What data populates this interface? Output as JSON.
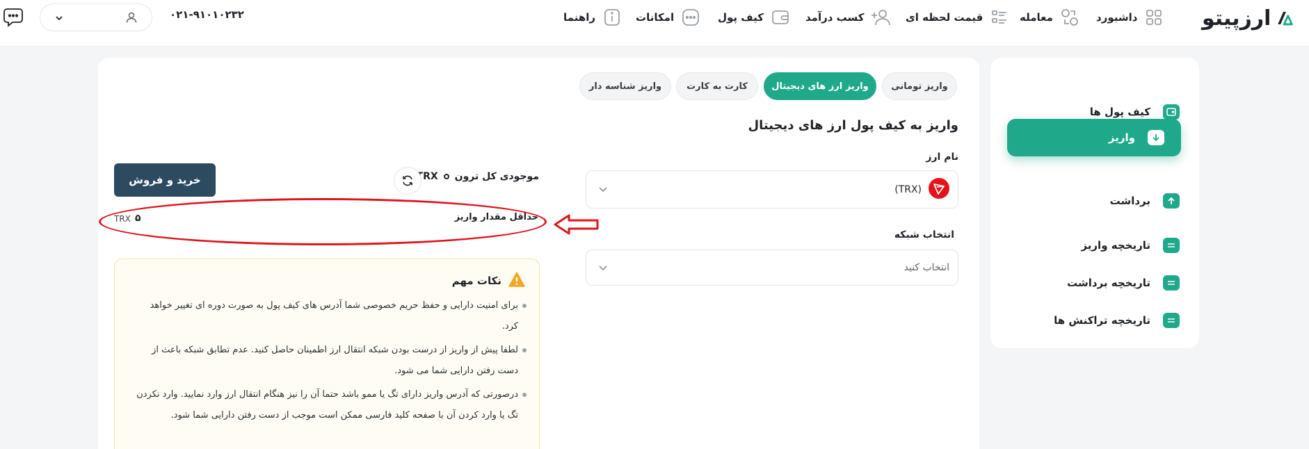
{
  "navbar": {
    "logo_text": "ارزپیتو",
    "items": [
      {
        "label": "داشبورد",
        "icon": "grid-icon"
      },
      {
        "label": "معامله",
        "icon": "exchange-icon"
      },
      {
        "label": "قیمت لحظه ای",
        "icon": "list-icon"
      },
      {
        "label": "کسب درآمد",
        "icon": "user-plus-icon"
      },
      {
        "label": "کیف پول",
        "icon": "wallet-icon"
      },
      {
        "label": "امکانات",
        "icon": "dots-icon"
      },
      {
        "label": "راهنما",
        "icon": "info-icon"
      }
    ],
    "phone": "۰۲۱-۹۱۰۱۰۲۳۲"
  },
  "sidebar": {
    "items": [
      {
        "label": "کیف پول ها"
      },
      {
        "label": "واریز"
      },
      {
        "label": "برداشت"
      },
      {
        "label": "تاریخچه واریز"
      },
      {
        "label": "تاریخچه برداشت"
      },
      {
        "label": "تاریخچه تراکنش ها"
      }
    ],
    "active_index": 1
  },
  "tabs": [
    {
      "label": "واریز تومانی"
    },
    {
      "label": "واریز ارز های دیجیتال"
    },
    {
      "label": "کارت به کارت"
    },
    {
      "label": "واریز شناسه دار"
    }
  ],
  "main": {
    "title": "واریز به کیف پول ارز های دیجیتال",
    "currency_label": "نام ارز",
    "currency_value": "(TRX)",
    "network_label": "انتخاب شبکه",
    "network_placeholder": "انتخاب کنید",
    "balance_label": "موجودی کل ترون",
    "balance_unit": "TRX",
    "buy_sell_label": "خرید و فروش",
    "min_deposit_label": "حداقل مقدار واریز",
    "min_deposit_value": "۵",
    "min_deposit_unit": "TRX"
  },
  "notes": {
    "title": "نکات مهم",
    "items": [
      "برای امنیت دارایی و حفظ حریم خصوصی شما آدرس های کیف پول به صورت دوره ای تغییر خواهد کرد.",
      "لطفا پیش از واریز از درست بودن شبکه انتقال ارز اطمینان حاصل کنید. عدم تطابق شبکه باعث از دست رفتن دارایی شما می شود.",
      "درصورتی که آدرس واریز دارای تگ یا ممو باشد حتما آن را نیز هنگام انتقال ارز وارد نمایید. وارد نکردن تگ یا وارد کردن آن با صفحه کلید فارسی ممکن است موجب از دست رفتن دارایی شما شود."
    ]
  },
  "colors": {
    "accent": "#1fa98a",
    "buy_button": "#2c4a60",
    "highlight": "#e0151c",
    "tron": "#e5121b"
  }
}
